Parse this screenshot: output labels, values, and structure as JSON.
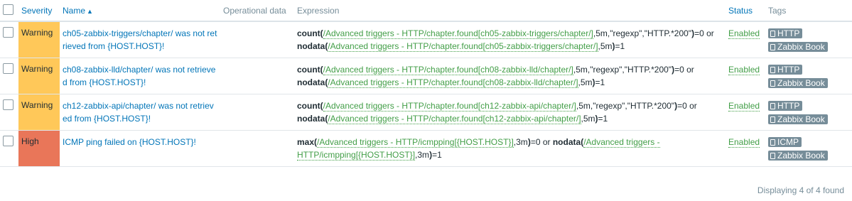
{
  "headers": {
    "severity": "Severity",
    "name": "Name",
    "name_sort_indicator": "▲",
    "operational_data": "Operational data",
    "expression": "Expression",
    "status": "Status",
    "tags": "Tags"
  },
  "colors": {
    "warning": "#ffc859",
    "high": "#e97659",
    "link": "#0275b8",
    "enabled": "#429e47",
    "tag_bg": "#768d99"
  },
  "rows": [
    {
      "severity": "Warning",
      "name": "ch05-zabbix-triggers/chapter/ was not retrieved from {HOST.HOST}!",
      "expr": {
        "f1": "count",
        "p1": "(",
        "i1": "/Advanced triggers - HTTP/chapter.found[ch05-zabbix-triggers/chapter/]",
        "a1": ",5m,\"regexp\",\"HTTP.*200\"",
        "c1": ")",
        "t1": "=0 or ",
        "f2": "nodata",
        "p2": "(",
        "i2": "/Advanced triggers - HTTP/chapter.found[ch05-zabbix-triggers/chapter/]",
        "a2": ",5m",
        "c2": ")",
        "t2": "=1"
      },
      "status": "Enabled",
      "tags": [
        "HTTP",
        "Zabbix Book"
      ]
    },
    {
      "severity": "Warning",
      "name": "ch08-zabbix-lld/chapter/ was not retrieved from {HOST.HOST}!",
      "expr": {
        "f1": "count",
        "p1": "(",
        "i1": "/Advanced triggers - HTTP/chapter.found[ch08-zabbix-lld/chapter/]",
        "a1": ",5m,\"regexp\",\"HTTP.*200\"",
        "c1": ")",
        "t1": "=0 or ",
        "f2": "nodata",
        "p2": "(",
        "i2": "/Advanced triggers - HTTP/chapter.found[ch08-zabbix-lld/chapter/]",
        "a2": ",5m",
        "c2": ")",
        "t2": "=1"
      },
      "status": "Enabled",
      "tags": [
        "HTTP",
        "Zabbix Book"
      ]
    },
    {
      "severity": "Warning",
      "name": "ch12-zabbix-api/chapter/ was not retrieved from {HOST.HOST}!",
      "expr": {
        "f1": "count",
        "p1": "(",
        "i1": "/Advanced triggers - HTTP/chapter.found[ch12-zabbix-api/chapter/]",
        "a1": ",5m,\"regexp\",\"HTTP.*200\"",
        "c1": ")",
        "t1": "=0 or ",
        "f2": "nodata",
        "p2": "(",
        "i2": "/Advanced triggers - HTTP/chapter.found[ch12-zabbix-api/chapter/]",
        "a2": ",5m",
        "c2": ")",
        "t2": "=1"
      },
      "status": "Enabled",
      "tags": [
        "HTTP",
        "Zabbix Book"
      ]
    },
    {
      "severity": "High",
      "name": "ICMP ping failed on {HOST.HOST}!",
      "expr": {
        "f1": "max",
        "p1": "(",
        "i1": "/Advanced triggers - HTTP/icmpping[{HOST.HOST}]",
        "a1": ",3m",
        "c1": ")",
        "t1": "=0 or ",
        "f2": "nodata",
        "p2": "(",
        "i2": "/Advanced triggers - HTTP/icmpping[{HOST.HOST}]",
        "a2": ",3m",
        "c2": ")",
        "t2": "=1"
      },
      "status": "Enabled",
      "tags": [
        "ICMP",
        "Zabbix Book"
      ]
    }
  ],
  "footer": "Displaying 4 of 4 found"
}
